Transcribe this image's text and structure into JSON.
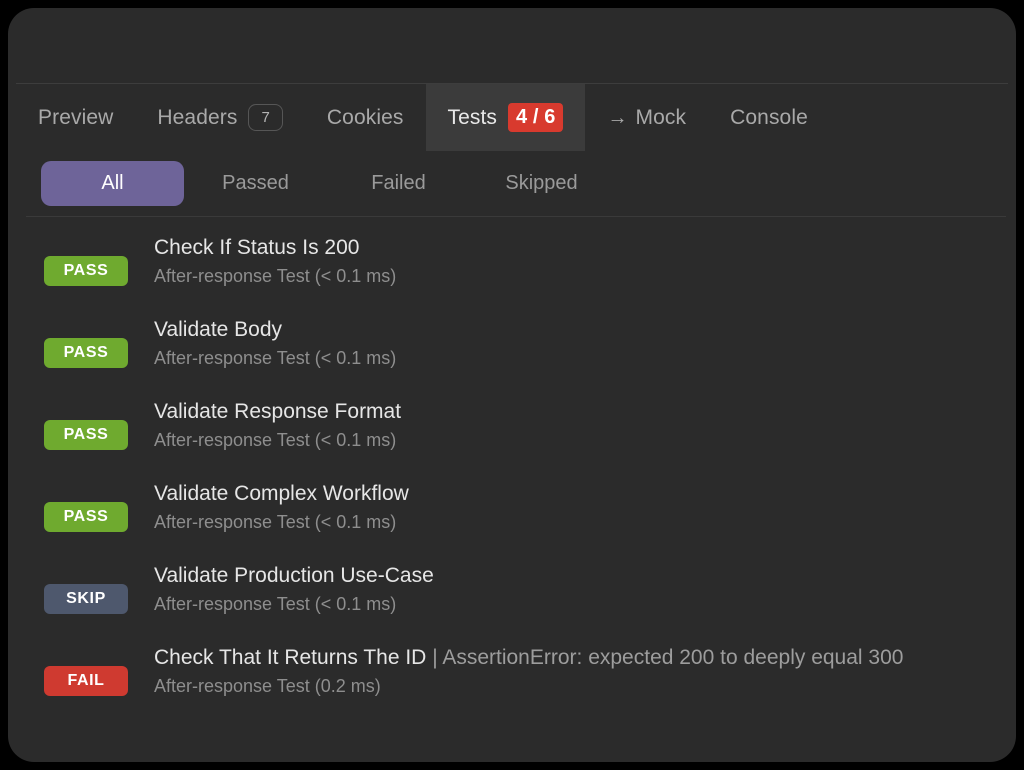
{
  "theme": {
    "window_bg": "#2b2b2b",
    "page_bg": "#000000",
    "accent_purple": "#6e6499",
    "pass_green": "#6faa2f",
    "fail_red": "#cf3a30",
    "skip_slate": "#4e586d",
    "badge_red": "#d83a2e"
  },
  "tabs": [
    {
      "label": "Preview",
      "count": null,
      "icon": null,
      "active": false
    },
    {
      "label": "Headers",
      "count": "7",
      "icon": null,
      "active": false
    },
    {
      "label": "Cookies",
      "count": null,
      "icon": null,
      "active": false
    },
    {
      "label": "Tests",
      "count": "4 / 6",
      "icon": null,
      "active": true
    },
    {
      "label": "Mock",
      "count": null,
      "icon": "arrow-right-icon",
      "active": false
    },
    {
      "label": "Console",
      "count": null,
      "icon": null,
      "active": false
    }
  ],
  "filters": [
    {
      "label": "All",
      "active": true
    },
    {
      "label": "Passed",
      "active": false
    },
    {
      "label": "Failed",
      "active": false
    },
    {
      "label": "Skipped",
      "active": false
    }
  ],
  "results": [
    {
      "status": "PASS",
      "status_kind": "pass",
      "title": "Check If Status Is 200",
      "error": "",
      "subtitle": "After-response Test (< 0.1 ms)"
    },
    {
      "status": "PASS",
      "status_kind": "pass",
      "title": "Validate Body",
      "error": "",
      "subtitle": "After-response Test (< 0.1 ms)"
    },
    {
      "status": "PASS",
      "status_kind": "pass",
      "title": "Validate Response Format",
      "error": "",
      "subtitle": "After-response Test (< 0.1 ms)"
    },
    {
      "status": "PASS",
      "status_kind": "pass",
      "title": "Validate Complex Workflow",
      "error": "",
      "subtitle": "After-response Test (< 0.1 ms)"
    },
    {
      "status": "SKIP",
      "status_kind": "skip",
      "title": "Validate Production Use-Case",
      "error": "",
      "subtitle": "After-response Test (< 0.1 ms)"
    },
    {
      "status": "FAIL",
      "status_kind": "fail",
      "title": "Check That It Returns The ID",
      "error": "| AssertionError: expected 200 to deeply equal 300",
      "subtitle": "After-response Test (0.2 ms)"
    }
  ],
  "icons": {
    "arrow_right": "→"
  }
}
